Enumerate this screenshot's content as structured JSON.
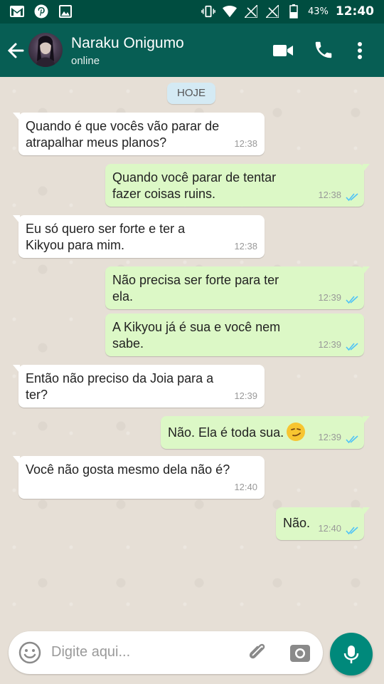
{
  "status_bar": {
    "icons_left": [
      "gmail-icon",
      "pinterest-icon",
      "image-icon"
    ],
    "battery": "43%",
    "time": "12:40"
  },
  "header": {
    "contact_name": "Naraku Onigumo",
    "contact_status": "online",
    "icons": [
      "back-arrow-icon",
      "video-call-icon",
      "phone-icon",
      "more-vert-icon"
    ]
  },
  "chat": {
    "date_label": "HOJE",
    "messages": [
      {
        "dir": "in",
        "text": "Quando é que vocês vão parar de atrapalhar meus planos?",
        "time": "12:38"
      },
      {
        "dir": "out",
        "text": "Quando você parar de tentar fazer coisas ruins.",
        "time": "12:38",
        "read": true
      },
      {
        "dir": "in",
        "text": "Eu só quero ser forte e ter a Kikyou para mim.",
        "time": "12:38"
      },
      {
        "dir": "out",
        "text": "Não precisa ser forte para ter ela.",
        "time": "12:39",
        "read": true
      },
      {
        "dir": "out",
        "text": "A Kikyou já é sua e você nem sabe.",
        "time": "12:39",
        "read": true
      },
      {
        "dir": "in",
        "text": "Então não preciso da Joia para a ter?",
        "time": "12:39"
      },
      {
        "dir": "out",
        "text": "Não. Ela é toda sua.",
        "time": "12:39",
        "read": true,
        "emoji": "smirking-face"
      },
      {
        "dir": "in",
        "text": "Você não gosta mesmo dela não é?",
        "time": "12:40"
      },
      {
        "dir": "out",
        "text": "Não.",
        "time": "12:40",
        "read": true
      }
    ]
  },
  "composer": {
    "placeholder": "Digite aqui...",
    "icons": [
      "emoji-icon",
      "attach-icon",
      "camera-icon",
      "mic-icon"
    ]
  },
  "colors": {
    "status_bar": "#004d40",
    "app_bar": "#075e54",
    "outgoing_bubble": "#dcf8c6",
    "incoming_bubble": "#ffffff",
    "mic_button": "#00897b",
    "read_ticks": "#4fc3f7"
  }
}
